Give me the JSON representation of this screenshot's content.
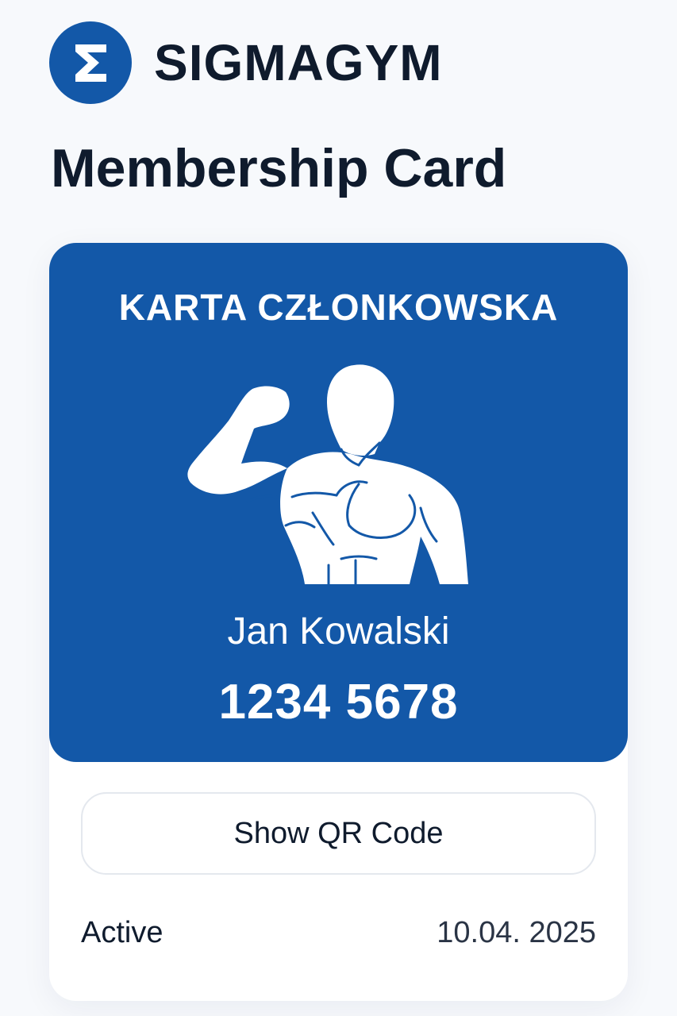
{
  "brand": {
    "logo_icon": "sigma-icon",
    "logo_glyph": "Σ",
    "name": "SIGMAGYM",
    "color": "#1358a8"
  },
  "page": {
    "title": "Membership Card"
  },
  "card": {
    "heading": "KARTA CZŁONKOWSKA",
    "figure_icon": "bodybuilder-icon",
    "member_name": "Jan Kowalski",
    "member_number": "1234 5678",
    "background_color": "#1358a8"
  },
  "actions": {
    "show_qr_label": "Show QR Code"
  },
  "status": {
    "label": "Active",
    "date": "10.04. 2025"
  }
}
